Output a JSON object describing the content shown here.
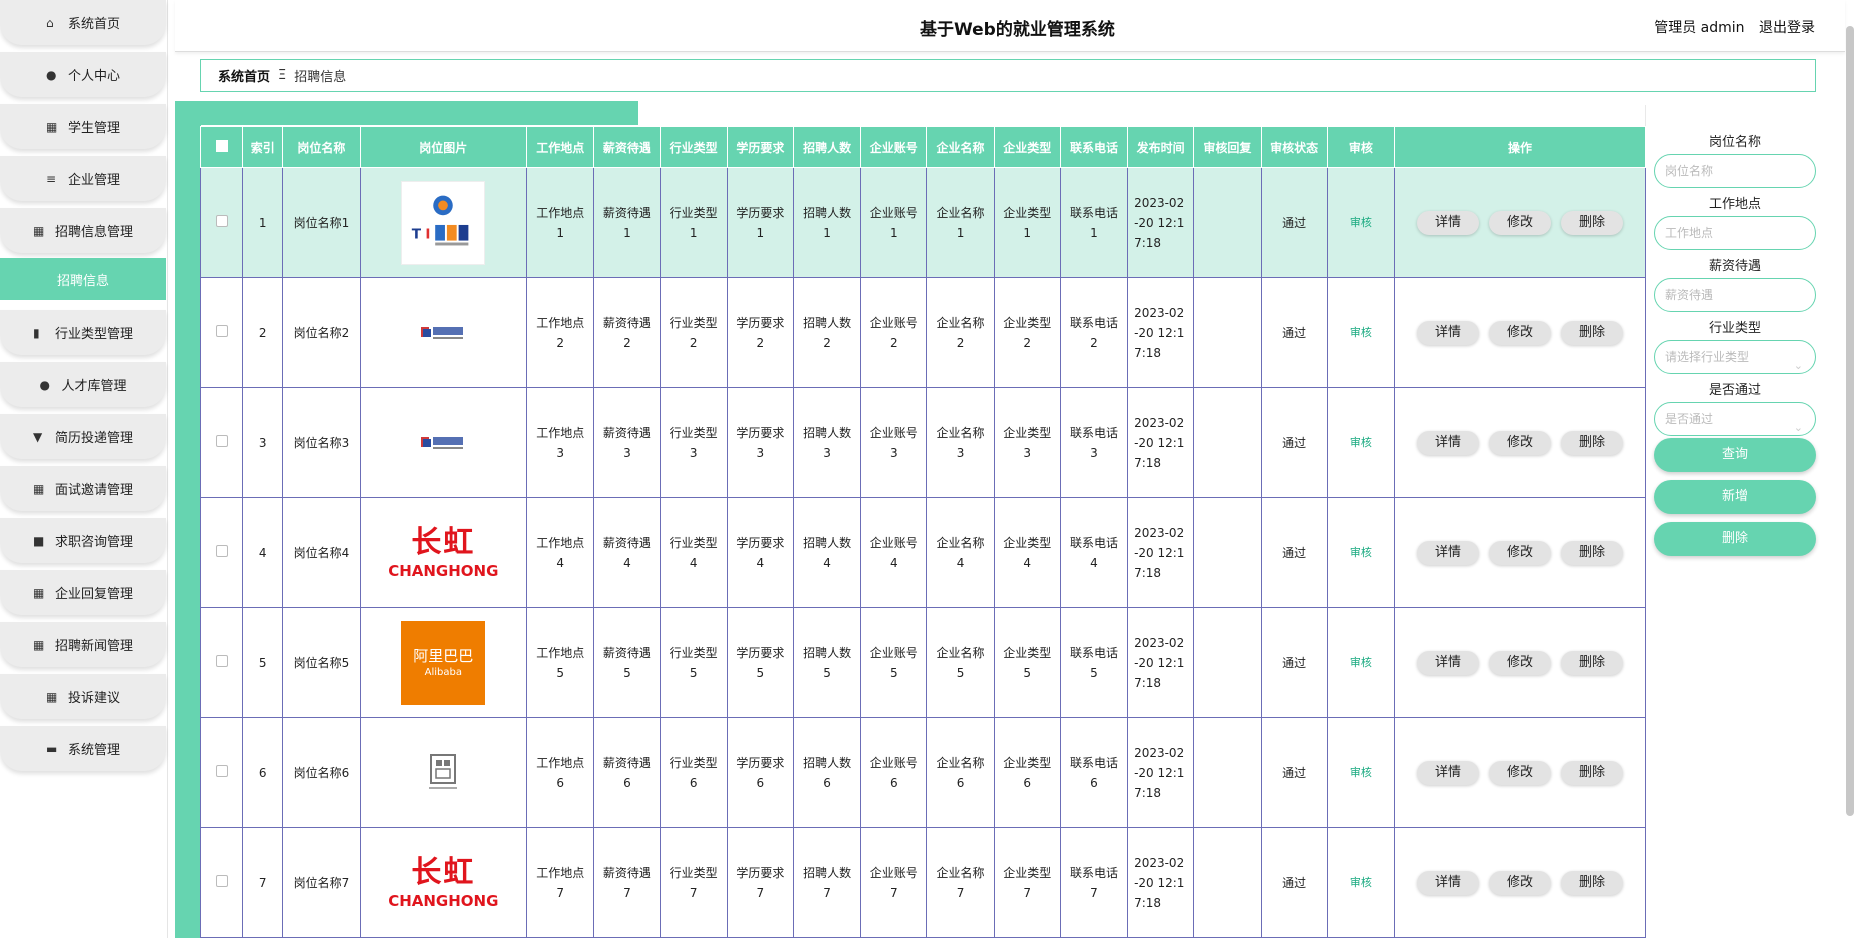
{
  "app": {
    "title": "基于Web的就业管理系统",
    "user": "管理员 admin",
    "logout": "退出登录"
  },
  "sidebar": {
    "items": [
      {
        "label": "系统首页",
        "icon": "home-icon"
      },
      {
        "label": "个人中心",
        "icon": "user-icon"
      },
      {
        "label": "学生管理",
        "icon": "grid-icon"
      },
      {
        "label": "企业管理",
        "icon": "sliders-icon"
      },
      {
        "label": "招聘信息管理",
        "icon": "grid-icon"
      },
      {
        "label": "招聘信息",
        "icon": "",
        "active": true
      },
      {
        "label": "行业类型管理",
        "icon": "bar-chart-icon"
      },
      {
        "label": "人才库管理",
        "icon": "bulb-icon"
      },
      {
        "label": "简历投递管理",
        "icon": "trophy-icon"
      },
      {
        "label": "面试邀请管理",
        "icon": "grid-icon"
      },
      {
        "label": "求职咨询管理",
        "icon": "printer-icon"
      },
      {
        "label": "企业回复管理",
        "icon": "grid-icon"
      },
      {
        "label": "招聘新闻管理",
        "icon": "dots-grid-icon"
      },
      {
        "label": "投诉建议",
        "icon": "grid-icon"
      },
      {
        "label": "系统管理",
        "icon": "briefcase-icon"
      }
    ]
  },
  "breadcrumb": {
    "home": "系统首页",
    "sep": "Ξ",
    "current": "招聘信息"
  },
  "table": {
    "headers": [
      "",
      "索引",
      "岗位名称",
      "岗位图片",
      "工作地点",
      "薪资待遇",
      "行业类型",
      "学历要求",
      "招聘人数",
      "企业账号",
      "企业名称",
      "企业类型",
      "联系电话",
      "发布时间",
      "审核回复",
      "审核状态",
      "审核",
      "操作"
    ],
    "rows": [
      {
        "index": "1",
        "name": "岗位名称1",
        "logo": "ti",
        "place": "工作地点1",
        "salary": "薪资待遇1",
        "industry": "行业类型1",
        "edu": "学历要求1",
        "count": "招聘人数1",
        "account": "企业账号1",
        "company": "企业名称1",
        "ctype": "企业类型1",
        "phone": "联系电话1",
        "time": "2023-02-20 12:17:18",
        "reply": "",
        "status": "通过",
        "audit": "审核"
      },
      {
        "index": "2",
        "name": "岗位名称2",
        "logo": "job",
        "place": "工作地点2",
        "salary": "薪资待遇2",
        "industry": "行业类型2",
        "edu": "学历要求2",
        "count": "招聘人数2",
        "account": "企业账号2",
        "company": "企业名称2",
        "ctype": "企业类型2",
        "phone": "联系电话2",
        "time": "2023-02-20 12:17:18",
        "reply": "",
        "status": "通过",
        "audit": "审核"
      },
      {
        "index": "3",
        "name": "岗位名称3",
        "logo": "job",
        "place": "工作地点3",
        "salary": "薪资待遇3",
        "industry": "行业类型3",
        "edu": "学历要求3",
        "count": "招聘人数3",
        "account": "企业账号3",
        "company": "企业名称3",
        "ctype": "企业类型3",
        "phone": "联系电话3",
        "time": "2023-02-20 12:17:18",
        "reply": "",
        "status": "通过",
        "audit": "审核"
      },
      {
        "index": "4",
        "name": "岗位名称4",
        "logo": "changhong",
        "place": "工作地点4",
        "salary": "薪资待遇4",
        "industry": "行业类型4",
        "edu": "学历要求4",
        "count": "招聘人数4",
        "account": "企业账号4",
        "company": "企业名称4",
        "ctype": "企业类型4",
        "phone": "联系电话4",
        "time": "2023-02-20 12:17:18",
        "reply": "",
        "status": "通过",
        "audit": "审核"
      },
      {
        "index": "5",
        "name": "岗位名称5",
        "logo": "alibaba",
        "place": "工作地点5",
        "salary": "薪资待遇5",
        "industry": "行业类型5",
        "edu": "学历要求5",
        "count": "招聘人数5",
        "account": "企业账号5",
        "company": "企业名称5",
        "ctype": "企业类型5",
        "phone": "联系电话5",
        "time": "2023-02-20 12:17:18",
        "reply": "",
        "status": "通过",
        "audit": "审核"
      },
      {
        "index": "6",
        "name": "岗位名称6",
        "logo": "seal",
        "place": "工作地点6",
        "salary": "薪资待遇6",
        "industry": "行业类型6",
        "edu": "学历要求6",
        "count": "招聘人数6",
        "account": "企业账号6",
        "company": "企业名称6",
        "ctype": "企业类型6",
        "phone": "联系电话6",
        "time": "2023-02-20 12:17:18",
        "reply": "",
        "status": "通过",
        "audit": "审核"
      },
      {
        "index": "7",
        "name": "岗位名称7",
        "logo": "changhong",
        "place": "工作地点7",
        "salary": "薪资待遇7",
        "industry": "行业类型7",
        "edu": "学历要求7",
        "count": "招聘人数7",
        "account": "企业账号7",
        "company": "企业名称7",
        "ctype": "企业类型7",
        "phone": "联系电话7",
        "time": "2023-02-20 12:17:18",
        "reply": "",
        "status": "通过",
        "audit": "审核"
      }
    ],
    "ops": {
      "detail": "详情",
      "edit": "修改",
      "delete": "删除"
    }
  },
  "logos": {
    "changhong_cn": "长虹",
    "changhong_en": "CHANGHONG",
    "alibaba_cn": "阿里巴巴",
    "alibaba_en": "Alibaba"
  },
  "search": {
    "name_label": "岗位名称",
    "name_placeholder": "岗位名称",
    "place_label": "工作地点",
    "place_placeholder": "工作地点",
    "salary_label": "薪资待遇",
    "salary_placeholder": "薪资待遇",
    "industry_label": "行业类型",
    "industry_placeholder": "请选择行业类型",
    "pass_label": "是否通过",
    "pass_placeholder": "是否通过",
    "query": "查询",
    "add": "新增",
    "delete": "删除"
  },
  "colors": {
    "accent": "#66d4b0",
    "table_border": "#6b6db6",
    "highlight_row": "#d3f1e8"
  }
}
